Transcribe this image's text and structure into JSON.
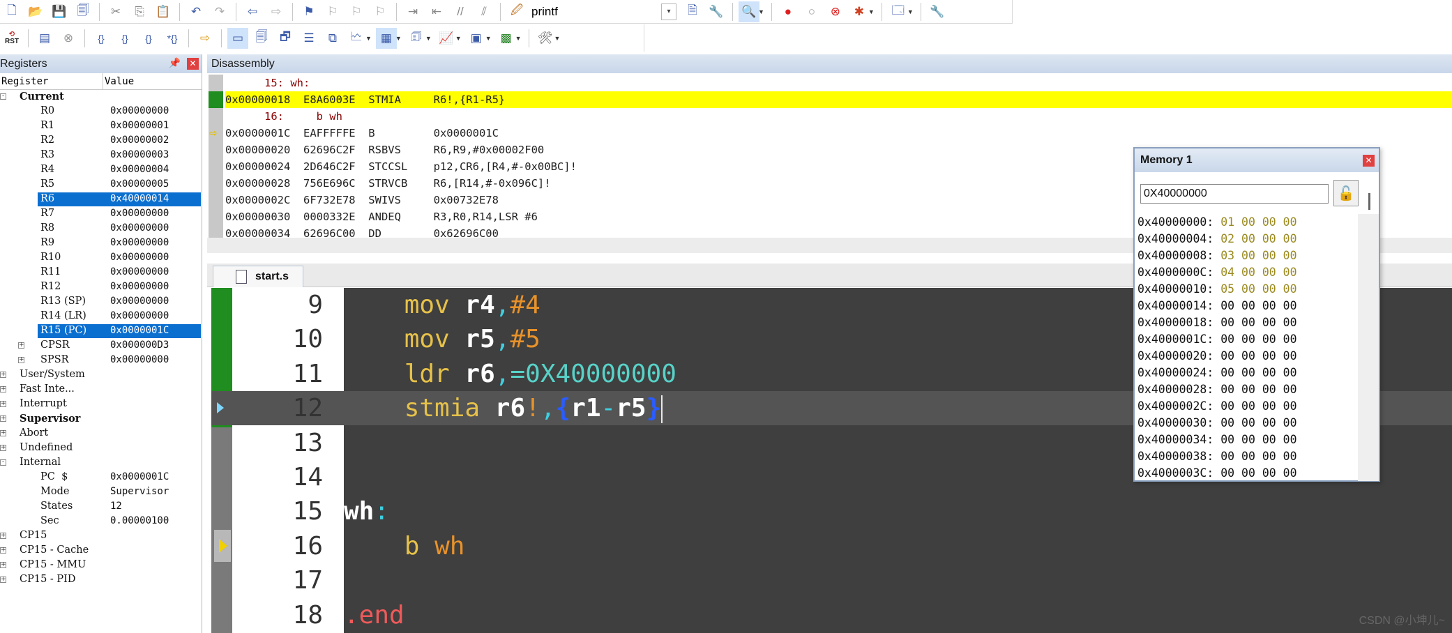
{
  "toolbar1": {
    "icons": [
      "new-file-icon",
      "open-folder-icon",
      "save-icon",
      "save-all-icon",
      "cut-icon",
      "copy-icon",
      "paste-icon",
      "undo-icon",
      "redo-icon",
      "nav-back-icon",
      "nav-forward-icon",
      "bookmark-icon",
      "bookmark-prev-icon",
      "bookmark-next-icon",
      "bookmark-clear-icon",
      "indent-icon",
      "unindent-icon",
      "comment-icon",
      "uncomment-icon",
      "find-in-files-icon"
    ],
    "search_text": "printf",
    "right_icons": [
      "find-icon",
      "replace-icon",
      "debug-start-icon",
      "breakpoint-icon",
      "breakpoint-disable-icon",
      "breakpoint-clear-icon",
      "breakpoint-kill-icon",
      "window-icon",
      "settings-icon"
    ]
  },
  "toolbar2": {
    "icons": [
      "reset-cpu-icon",
      "run-icon",
      "stop-icon",
      "step-into-icon",
      "step-over-icon",
      "step-out-icon",
      "run-to-cursor-icon",
      "show-next-statement-icon",
      "command-window-icon",
      "disassembly-window-icon",
      "symbols-window-icon",
      "registers-window-icon",
      "call-stack-icon",
      "watch-window-icon",
      "memory-window-icon",
      "serial-window-icon",
      "analysis-window-icon",
      "trace-window-icon",
      "system-viewer-icon",
      "toolbox-icon"
    ],
    "rst_label": "RST"
  },
  "registers": {
    "title": "Registers",
    "col_register": "Register",
    "col_value": "Value",
    "rows": [
      {
        "name": "Current",
        "value": "",
        "bold": true,
        "indent": 1,
        "expand": "-"
      },
      {
        "name": "R0",
        "value": "0x00000000",
        "indent": 2
      },
      {
        "name": "R1",
        "value": "0x00000001",
        "indent": 2
      },
      {
        "name": "R2",
        "value": "0x00000002",
        "indent": 2
      },
      {
        "name": "R3",
        "value": "0x00000003",
        "indent": 2
      },
      {
        "name": "R4",
        "value": "0x00000004",
        "indent": 2
      },
      {
        "name": "R5",
        "value": "0x00000005",
        "indent": 2
      },
      {
        "name": "R6",
        "value": "0x40000014",
        "indent": 2,
        "selected": true
      },
      {
        "name": "R7",
        "value": "0x00000000",
        "indent": 2
      },
      {
        "name": "R8",
        "value": "0x00000000",
        "indent": 2
      },
      {
        "name": "R9",
        "value": "0x00000000",
        "indent": 2
      },
      {
        "name": "R10",
        "value": "0x00000000",
        "indent": 2
      },
      {
        "name": "R11",
        "value": "0x00000000",
        "indent": 2
      },
      {
        "name": "R12",
        "value": "0x00000000",
        "indent": 2
      },
      {
        "name": "R13 (SP)",
        "value": "0x00000000",
        "indent": 2
      },
      {
        "name": "R14 (LR)",
        "value": "0x00000000",
        "indent": 2
      },
      {
        "name": "R15 (PC)",
        "value": "0x0000001C",
        "indent": 2,
        "selected": true
      },
      {
        "name": "CPSR",
        "value": "0x000000D3",
        "indent": 2,
        "expand": "+"
      },
      {
        "name": "SPSR",
        "value": "0x00000000",
        "indent": 2,
        "expand": "+"
      },
      {
        "name": "User/System",
        "value": "",
        "indent": 1,
        "expand": "+"
      },
      {
        "name": "Fast Inte...",
        "value": "",
        "indent": 1,
        "expand": "+"
      },
      {
        "name": "Interrupt",
        "value": "",
        "indent": 1,
        "expand": "+"
      },
      {
        "name": "Supervisor",
        "value": "",
        "indent": 1,
        "expand": "+",
        "bold": true
      },
      {
        "name": "Abort",
        "value": "",
        "indent": 1,
        "expand": "+"
      },
      {
        "name": "Undefined",
        "value": "",
        "indent": 1,
        "expand": "+"
      },
      {
        "name": "Internal",
        "value": "",
        "indent": 1,
        "expand": "-"
      },
      {
        "name": "PC  $",
        "value": "0x0000001C",
        "indent": 2
      },
      {
        "name": "Mode",
        "value": "Supervisor",
        "indent": 2
      },
      {
        "name": "States",
        "value": "12",
        "indent": 2
      },
      {
        "name": "Sec",
        "value": "0.00000100",
        "indent": 2
      },
      {
        "name": "CP15",
        "value": "",
        "indent": 1,
        "expand": "+"
      },
      {
        "name": "CP15 - Cache",
        "value": "",
        "indent": 1,
        "expand": "+"
      },
      {
        "name": "CP15 - MMU",
        "value": "",
        "indent": 1,
        "expand": "+"
      },
      {
        "name": "CP15 - PID",
        "value": "",
        "indent": 1,
        "expand": "+"
      }
    ]
  },
  "disassembly": {
    "title": "Disassembly",
    "lines": [
      {
        "text": "      15: wh:",
        "kind": "src"
      },
      {
        "text": "0x00000018  E8A6003E  STMIA     R6!,{R1-R5}",
        "kind": "hl"
      },
      {
        "text": "      16:     b wh",
        "kind": "src"
      },
      {
        "text": "0x0000001C  EAFFFFFE  B         0x0000001C",
        "kind": "cur"
      },
      {
        "text": "0x00000020  62696C2F  RSBVS     R6,R9,#0x00002F00",
        "kind": ""
      },
      {
        "text": "0x00000024  2D646C2F  STCCSL    p12,CR6,[R4,#-0x00BC]!",
        "kind": ""
      },
      {
        "text": "0x00000028  756E696C  STRVCB    R6,[R14,#-0x096C]!",
        "kind": ""
      },
      {
        "text": "0x0000002C  6F732E78  SWIVS     0x00732E78",
        "kind": ""
      },
      {
        "text": "0x00000030  0000332E  ANDEQ     R3,R0,R14,LSR #6",
        "kind": ""
      },
      {
        "text": "0x00000034  62696C00  DD        0x62696C00",
        "kind": ""
      }
    ]
  },
  "editor": {
    "tab_label": "start.s",
    "lines": [
      {
        "num": "9",
        "tokens": [
          [
            "    ",
            ""
          ],
          [
            "mov",
            "kw"
          ],
          [
            " ",
            ""
          ],
          [
            "r4",
            "rg"
          ],
          [
            ",",
            "pn"
          ],
          [
            "#4",
            "im"
          ]
        ]
      },
      {
        "num": "10",
        "tokens": [
          [
            "    ",
            ""
          ],
          [
            "mov",
            "kw"
          ],
          [
            " ",
            ""
          ],
          [
            "r5",
            "rg"
          ],
          [
            ",",
            "pn"
          ],
          [
            "#5",
            "im"
          ]
        ]
      },
      {
        "num": "11",
        "tokens": [
          [
            "    ",
            ""
          ],
          [
            "ldr",
            "kw"
          ],
          [
            " ",
            ""
          ],
          [
            "r6",
            "rg"
          ],
          [
            ",",
            "pn"
          ],
          [
            "=0X40000000",
            "hx"
          ]
        ]
      },
      {
        "num": "12",
        "tokens": [
          [
            "    ",
            ""
          ],
          [
            "stmia",
            "kw"
          ],
          [
            " ",
            ""
          ],
          [
            "r6",
            "rg"
          ],
          [
            "!",
            "br"
          ],
          [
            ",",
            "pn"
          ],
          [
            "{",
            "bl"
          ],
          [
            "r1",
            "rg"
          ],
          [
            "-",
            "pn"
          ],
          [
            "r5",
            "rg"
          ],
          [
            "}",
            "bl"
          ]
        ],
        "current": true
      },
      {
        "num": "13",
        "tokens": []
      },
      {
        "num": "14",
        "tokens": []
      },
      {
        "num": "15",
        "tokens": [
          [
            "wh",
            "lb"
          ],
          [
            ":",
            "lbc"
          ]
        ]
      },
      {
        "num": "16",
        "tokens": [
          [
            "    ",
            ""
          ],
          [
            "b",
            "kw"
          ],
          [
            " ",
            ""
          ],
          [
            "wh",
            "br"
          ]
        ],
        "exec": true
      },
      {
        "num": "17",
        "tokens": []
      },
      {
        "num": "18",
        "tokens": [
          [
            ".end",
            "dr"
          ]
        ]
      }
    ]
  },
  "memory": {
    "title": "Memory 1",
    "address": "0X40000000",
    "rows": [
      {
        "addr": "0x40000000:",
        "bytes": [
          "01",
          "00",
          "00",
          "00"
        ],
        "changed": true
      },
      {
        "addr": "0x40000004:",
        "bytes": [
          "02",
          "00",
          "00",
          "00"
        ],
        "changed": true
      },
      {
        "addr": "0x40000008:",
        "bytes": [
          "03",
          "00",
          "00",
          "00"
        ],
        "changed": true
      },
      {
        "addr": "0x4000000C:",
        "bytes": [
          "04",
          "00",
          "00",
          "00"
        ],
        "changed": true
      },
      {
        "addr": "0x40000010:",
        "bytes": [
          "05",
          "00",
          "00",
          "00"
        ],
        "changed": true
      },
      {
        "addr": "0x40000014:",
        "bytes": [
          "00",
          "00",
          "00",
          "00"
        ]
      },
      {
        "addr": "0x40000018:",
        "bytes": [
          "00",
          "00",
          "00",
          "00"
        ]
      },
      {
        "addr": "0x4000001C:",
        "bytes": [
          "00",
          "00",
          "00",
          "00"
        ]
      },
      {
        "addr": "0x40000020:",
        "bytes": [
          "00",
          "00",
          "00",
          "00"
        ]
      },
      {
        "addr": "0x40000024:",
        "bytes": [
          "00",
          "00",
          "00",
          "00"
        ]
      },
      {
        "addr": "0x40000028:",
        "bytes": [
          "00",
          "00",
          "00",
          "00"
        ]
      },
      {
        "addr": "0x4000002C:",
        "bytes": [
          "00",
          "00",
          "00",
          "00"
        ]
      },
      {
        "addr": "0x40000030:",
        "bytes": [
          "00",
          "00",
          "00",
          "00"
        ]
      },
      {
        "addr": "0x40000034:",
        "bytes": [
          "00",
          "00",
          "00",
          "00"
        ]
      },
      {
        "addr": "0x40000038:",
        "bytes": [
          "00",
          "00",
          "00",
          "00"
        ]
      },
      {
        "addr": "0x4000003C:",
        "bytes": [
          "00",
          "00",
          "00",
          "00"
        ]
      }
    ]
  },
  "watermark": "CSDN @小坤儿~",
  "colors": {
    "highlight_line": "#ffff00",
    "selection": "#0b6fd0",
    "editor_bg": "#3f3f3f",
    "changed_mem": "#9a8a20"
  }
}
